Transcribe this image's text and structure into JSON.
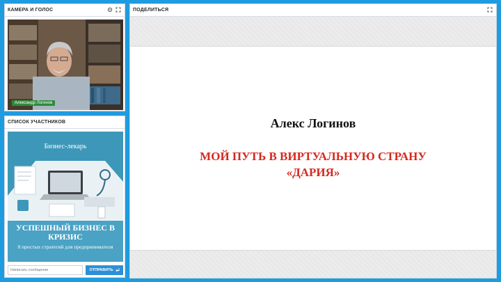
{
  "camera_panel": {
    "title": "КАМЕРА И ГОЛОС",
    "name_tag": "Александр Логинов"
  },
  "participants_panel": {
    "title": "СПИСОК УЧАСТНИКОВ",
    "book": {
      "top_text": "Бизнес-лекарь",
      "title": "УСПЕШНЫЙ БИЗНЕС В КРИЗИС",
      "subtitle": "8 простых стратегий для предпринимателя"
    },
    "chat": {
      "placeholder": "Написать сообщение",
      "send_label": "ОТПРАВИТЬ"
    }
  },
  "share_panel": {
    "title": "ПОДЕЛИТЬСЯ",
    "slide": {
      "author": "Алекс Логинов",
      "title": "МОЙ ПУТЬ  В ВИРТУАЛЬНУЮ СТРАНУ\n«ДАРИЯ»"
    }
  },
  "colors": {
    "background": "#1f9be0",
    "accent": "#2d8fd5",
    "slide_title": "#d42a20",
    "name_tag": "#2e8b3a"
  }
}
